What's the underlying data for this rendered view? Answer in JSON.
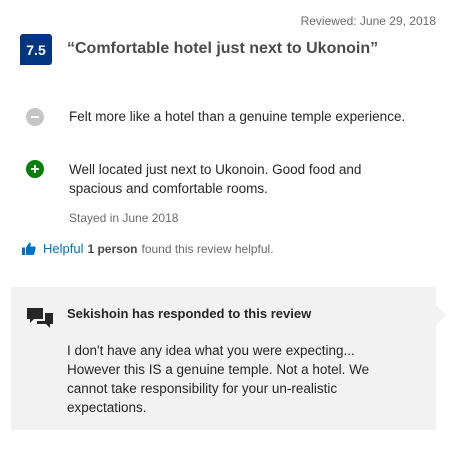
{
  "review": {
    "date": "Reviewed: June 29, 2018",
    "score": "7.5",
    "title": "“Comfortable hotel just next to Ukonoin”",
    "negative_icon": "minus-circle-icon",
    "negative": "Felt more like a hotel than a genuine temple experience.",
    "positive_icon": "plus-circle-icon",
    "positive": "Well located just next to Ukonoin.  Good food and spacious and comfortable rooms.",
    "stayed": "Stayed in June 2018"
  },
  "helpful": {
    "icon": "thumbs-up-icon",
    "label": "Helpful",
    "count": "1 person",
    "suffix": "found this review helpful."
  },
  "response": {
    "icon": "chat-bubbles-icon",
    "title": "Sekishoin has responded to this review",
    "body": "I don't have any idea what you were expecting... However this IS a genuine temple. Not a hotel. We cannot take responsibility for your un-realistic expectations."
  },
  "colors": {
    "score_badge": "#003580",
    "positive": "#008009",
    "negative": "#c6c6c6",
    "link": "#0071c2",
    "response_bg": "#f2f2f2"
  }
}
